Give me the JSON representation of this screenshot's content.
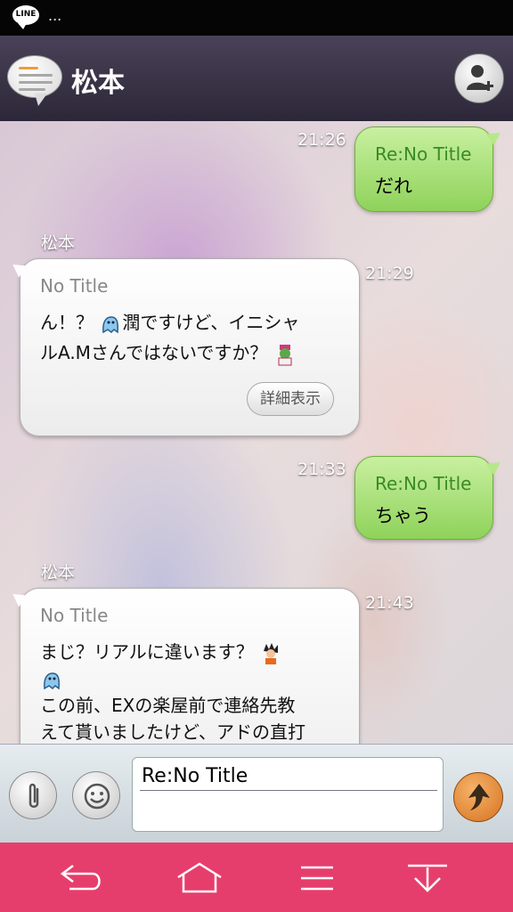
{
  "status_bar": {
    "app_badge": "LINE",
    "more": "..."
  },
  "header": {
    "title": "松本"
  },
  "messages": [
    {
      "dir": "out",
      "time": "21:26",
      "subject": "Re:No Title",
      "body": "だれ"
    },
    {
      "dir": "in",
      "sender": "松本",
      "time": "21:29",
      "subject": "No Title",
      "lines": [
        "ん！？",
        "潤ですけど、イニシャ",
        "ルA.Mさんではないですか？"
      ],
      "detail_button": "詳細表示"
    },
    {
      "dir": "out",
      "time": "21:33",
      "subject": "Re:No Title",
      "body": "ちゃう"
    },
    {
      "dir": "in",
      "sender": "松本",
      "time": "21:43",
      "subject": "No Title",
      "lines": [
        "まじ？リアルに違います？",
        "この前、EXの楽屋前で連絡先教",
        "えて貰いましたけど、アドの直打"
      ]
    }
  ],
  "composer": {
    "value": "Re:No Title"
  },
  "colors": {
    "nav_bar": "#e63e6c",
    "out_bubble": "#a4de72",
    "header": "#3a3447"
  },
  "icons": [
    "line-logo-icon",
    "chat-bubble-icon",
    "add-friend-icon",
    "paperclip-icon",
    "smiley-icon",
    "send-icon",
    "back-icon",
    "home-icon",
    "menu-icon",
    "hide-keyboard-icon"
  ]
}
